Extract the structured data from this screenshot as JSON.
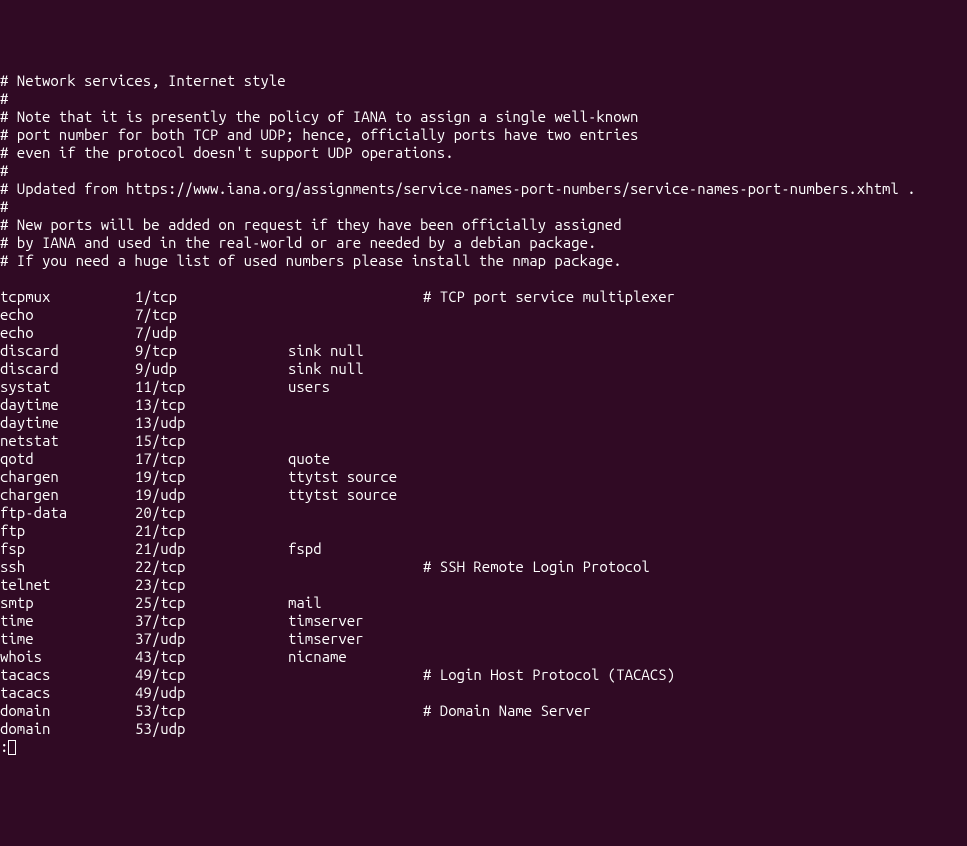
{
  "header": [
    "# Network services, Internet style",
    "#",
    "# Note that it is presently the policy of IANA to assign a single well-known",
    "# port number for both TCP and UDP; hence, officially ports have two entries",
    "# even if the protocol doesn't support UDP operations.",
    "#",
    "# Updated from https://www.iana.org/assignments/service-names-port-numbers/service-names-port-numbers.xhtml .",
    "#",
    "# New ports will be added on request if they have been officially assigned",
    "# by IANA and used in the real-world or are needed by a debian package.",
    "# If you need a huge list of used numbers please install the nmap package.",
    ""
  ],
  "services": [
    {
      "name": "tcpmux",
      "port": "1/tcp",
      "alias": "",
      "comment": "# TCP port service multiplexer"
    },
    {
      "name": "echo",
      "port": "7/tcp",
      "alias": "",
      "comment": ""
    },
    {
      "name": "echo",
      "port": "7/udp",
      "alias": "",
      "comment": ""
    },
    {
      "name": "discard",
      "port": "9/tcp",
      "alias": "sink null",
      "comment": ""
    },
    {
      "name": "discard",
      "port": "9/udp",
      "alias": "sink null",
      "comment": ""
    },
    {
      "name": "systat",
      "port": "11/tcp",
      "alias": "users",
      "comment": ""
    },
    {
      "name": "daytime",
      "port": "13/tcp",
      "alias": "",
      "comment": ""
    },
    {
      "name": "daytime",
      "port": "13/udp",
      "alias": "",
      "comment": ""
    },
    {
      "name": "netstat",
      "port": "15/tcp",
      "alias": "",
      "comment": ""
    },
    {
      "name": "qotd",
      "port": "17/tcp",
      "alias": "quote",
      "comment": ""
    },
    {
      "name": "chargen",
      "port": "19/tcp",
      "alias": "ttytst source",
      "comment": ""
    },
    {
      "name": "chargen",
      "port": "19/udp",
      "alias": "ttytst source",
      "comment": ""
    },
    {
      "name": "ftp-data",
      "port": "20/tcp",
      "alias": "",
      "comment": ""
    },
    {
      "name": "ftp",
      "port": "21/tcp",
      "alias": "",
      "comment": ""
    },
    {
      "name": "fsp",
      "port": "21/udp",
      "alias": "fspd",
      "comment": ""
    },
    {
      "name": "ssh",
      "port": "22/tcp",
      "alias": "",
      "comment": "# SSH Remote Login Protocol"
    },
    {
      "name": "telnet",
      "port": "23/tcp",
      "alias": "",
      "comment": ""
    },
    {
      "name": "smtp",
      "port": "25/tcp",
      "alias": "mail",
      "comment": ""
    },
    {
      "name": "time",
      "port": "37/tcp",
      "alias": "timserver",
      "comment": ""
    },
    {
      "name": "time",
      "port": "37/udp",
      "alias": "timserver",
      "comment": ""
    },
    {
      "name": "whois",
      "port": "43/tcp",
      "alias": "nicname",
      "comment": ""
    },
    {
      "name": "tacacs",
      "port": "49/tcp",
      "alias": "",
      "comment": "# Login Host Protocol (TACACS)"
    },
    {
      "name": "tacacs",
      "port": "49/udp",
      "alias": "",
      "comment": ""
    },
    {
      "name": "domain",
      "port": "53/tcp",
      "alias": "",
      "comment": "# Domain Name Server"
    },
    {
      "name": "domain",
      "port": "53/udp",
      "alias": "",
      "comment": ""
    }
  ],
  "prompt": ":"
}
